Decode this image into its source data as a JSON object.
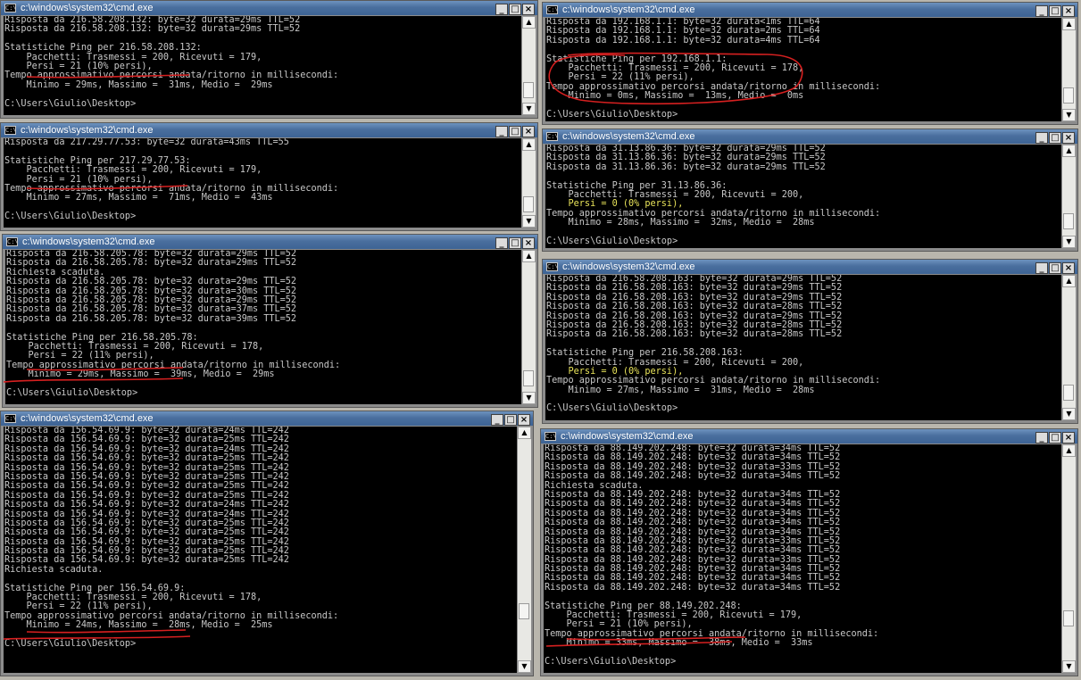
{
  "windows": [
    {
      "title": "c:\\windows\\system32\\cmd.exe",
      "icon": "cmd-icon",
      "thumb": 0.92,
      "lines": [
        "Risposta da 216.58.208.132: byte=32 durata=29ms TTL=52",
        "Risposta da 216.58.208.132: byte=32 durata=29ms TTL=52",
        "",
        "Statistiche Ping per 216.58.208.132:",
        "    Pacchetti: Trasmessi = 200, Ricevuti = 179,",
        "    Persi = 21 (10% persi),",
        "Tempo approssimativo percorsi andata/ritorno in millisecondi:",
        "    Minimo = 29ms, Massimo =  31ms, Medio =  29ms",
        "",
        "C:\\Users\\Giulio\\Desktop>"
      ],
      "highlight": []
    },
    {
      "title": "c:\\windows\\system32\\cmd.exe",
      "icon": "cmd-icon",
      "thumb": 0.95,
      "lines": [
        "Risposta da 217.29.77.53: byte=32 durata=43ms TTL=55",
        "",
        "Statistiche Ping per 217.29.77.53:",
        "    Pacchetti: Trasmessi = 200, Ricevuti = 179,",
        "    Persi = 21 (10% persi),",
        "Tempo approssimativo percorsi andata/ritorno in millisecondi:",
        "    Minimo = 27ms, Massimo =  71ms, Medio =  43ms",
        "",
        "C:\\Users\\Giulio\\Desktop>"
      ],
      "highlight": []
    },
    {
      "title": "c:\\windows\\system32\\cmd.exe",
      "icon": "cmd-icon",
      "thumb": 0.95,
      "lines": [
        "Risposta da 216.58.205.78: byte=32 durata=29ms TTL=52",
        "Risposta da 216.58.205.78: byte=32 durata=29ms TTL=52",
        "Richiesta scaduta.",
        "Risposta da 216.58.205.78: byte=32 durata=29ms TTL=52",
        "Risposta da 216.58.205.78: byte=32 durata=30ms TTL=52",
        "Risposta da 216.58.205.78: byte=32 durata=29ms TTL=52",
        "Risposta da 216.58.205.78: byte=32 durata=37ms TTL=52",
        "Risposta da 216.58.205.78: byte=32 durata=39ms TTL=52",
        "",
        "Statistiche Ping per 216.58.205.78:",
        "    Pacchetti: Trasmessi = 200, Ricevuti = 178,",
        "    Persi = 22 (11% persi),",
        "Tempo approssimativo percorsi andata/ritorno in millisecondi:",
        "    Minimo = 29ms, Massimo =  39ms, Medio =  29ms",
        "",
        "C:\\Users\\Giulio\\Desktop>"
      ],
      "highlight": []
    },
    {
      "title": "c:\\windows\\system32\\cmd.exe",
      "icon": "cmd-icon",
      "thumb": 0.8,
      "lines": [
        "Risposta da 156.54.69.9: byte=32 durata=24ms TTL=242",
        "Risposta da 156.54.69.9: byte=32 durata=25ms TTL=242",
        "Risposta da 156.54.69.9: byte=32 durata=24ms TTL=242",
        "Risposta da 156.54.69.9: byte=32 durata=25ms TTL=242",
        "Risposta da 156.54.69.9: byte=32 durata=25ms TTL=242",
        "Risposta da 156.54.69.9: byte=32 durata=25ms TTL=242",
        "Risposta da 156.54.69.9: byte=32 durata=25ms TTL=242",
        "Risposta da 156.54.69.9: byte=32 durata=25ms TTL=242",
        "Risposta da 156.54.69.9: byte=32 durata=24ms TTL=242",
        "Risposta da 156.54.69.9: byte=32 durata=24ms TTL=242",
        "Risposta da 156.54.69.9: byte=32 durata=25ms TTL=242",
        "Risposta da 156.54.69.9: byte=32 durata=25ms TTL=242",
        "Risposta da 156.54.69.9: byte=32 durata=25ms TTL=242",
        "Risposta da 156.54.69.9: byte=32 durata=25ms TTL=242",
        "Risposta da 156.54.69.9: byte=32 durata=25ms TTL=242",
        "Richiesta scaduta.",
        "",
        "Statistiche Ping per 156.54.69.9:",
        "    Pacchetti: Trasmessi = 200, Ricevuti = 178,",
        "    Persi = 22 (11% persi),",
        "Tempo approssimativo percorsi andata/ritorno in millisecondi:",
        "    Minimo = 24ms, Massimo =  28ms, Medio =  25ms",
        "",
        "C:\\Users\\Giulio\\Desktop>"
      ],
      "highlight": []
    },
    {
      "title": "c:\\windows\\system32\\cmd.exe",
      "icon": "cmd-icon",
      "thumb": 0.92,
      "lines": [
        "Risposta da 192.168.1.1: byte=32 durata<1ms TTL=64",
        "Risposta da 192.168.1.1: byte=32 durata=2ms TTL=64",
        "Risposta da 192.168.1.1: byte=32 durata=4ms TTL=64",
        "",
        "Statistiche Ping per 192.168.1.1:",
        "    Pacchetti: Trasmessi = 200, Ricevuti = 178,",
        "    Persi = 22 (11% persi),",
        "Tempo approssimativo percorsi andata/ritorno in millisecondi:",
        "    Minimo = 0ms, Massimo =  13ms, Medio =  0ms",
        "",
        "C:\\Users\\Giulio\\Desktop>"
      ],
      "highlight": []
    },
    {
      "title": "c:\\windows\\system32\\cmd.exe",
      "icon": "cmd-icon",
      "thumb": 0.9,
      "lines": [
        "Risposta da 31.13.86.36: byte=32 durata=29ms TTL=52",
        "Risposta da 31.13.86.36: byte=32 durata=29ms TTL=52",
        "Risposta da 31.13.86.36: byte=32 durata=29ms TTL=52",
        "",
        "Statistiche Ping per 31.13.86.36:",
        "    Pacchetti: Trasmessi = 200, Ricevuti = 200,",
        "    Persi = 0 (0% persi),",
        "Tempo approssimativo percorsi andata/ritorno in millisecondi:",
        "    Minimo = 28ms, Massimo =  32ms, Medio =  28ms",
        "",
        "C:\\Users\\Giulio\\Desktop>"
      ],
      "highlight": [
        6
      ]
    },
    {
      "title": "c:\\windows\\system32\\cmd.exe",
      "icon": "cmd-icon",
      "thumb": 0.93,
      "lines": [
        "Risposta da 216.58.208.163: byte=32 durata=29ms TTL=52",
        "Risposta da 216.58.208.163: byte=32 durata=29ms TTL=52",
        "Risposta da 216.58.208.163: byte=32 durata=29ms TTL=52",
        "Risposta da 216.58.208.163: byte=32 durata=28ms TTL=52",
        "Risposta da 216.58.208.163: byte=32 durata=29ms TTL=52",
        "Risposta da 216.58.208.163: byte=32 durata=28ms TTL=52",
        "Risposta da 216.58.208.163: byte=32 durata=28ms TTL=52",
        "",
        "Statistiche Ping per 216.58.208.163:",
        "    Pacchetti: Trasmessi = 200, Ricevuti = 200,",
        "    Persi = 0 (0% persi),",
        "Tempo approssimativo percorsi andata/ritorno in millisecondi:",
        "    Minimo = 27ms, Massimo =  31ms, Medio =  28ms",
        "",
        "C:\\Users\\Giulio\\Desktop>"
      ],
      "highlight": [
        10
      ]
    },
    {
      "title": "c:\\windows\\system32\\cmd.exe",
      "icon": "cmd-icon",
      "thumb": 0.82,
      "lines": [
        "Risposta da 88.149.202.248: byte=32 durata=34ms TTL=52",
        "Risposta da 88.149.202.248: byte=32 durata=34ms TTL=52",
        "Risposta da 88.149.202.248: byte=32 durata=33ms TTL=52",
        "Risposta da 88.149.202.248: byte=32 durata=34ms TTL=52",
        "Richiesta scaduta.",
        "Risposta da 88.149.202.248: byte=32 durata=34ms TTL=52",
        "Risposta da 88.149.202.248: byte=32 durata=34ms TTL=52",
        "Risposta da 88.149.202.248: byte=32 durata=34ms TTL=52",
        "Risposta da 88.149.202.248: byte=32 durata=34ms TTL=52",
        "Risposta da 88.149.202.248: byte=32 durata=34ms TTL=52",
        "Risposta da 88.149.202.248: byte=32 durata=33ms TTL=52",
        "Risposta da 88.149.202.248: byte=32 durata=34ms TTL=52",
        "Risposta da 88.149.202.248: byte=32 durata=33ms TTL=52",
        "Risposta da 88.149.202.248: byte=32 durata=34ms TTL=52",
        "Risposta da 88.149.202.248: byte=32 durata=34ms TTL=52",
        "Risposta da 88.149.202.248: byte=32 durata=34ms TTL=52",
        "",
        "Statistiche Ping per 88.149.202.248:",
        "    Pacchetti: Trasmessi = 200, Ricevuti = 179,",
        "    Persi = 21 (10% persi),",
        "Tempo approssimativo percorsi andata/ritorno in millisecondi:",
        "    Minimo = 33ms, Massimo =  38ms, Medio =  33ms",
        "",
        "C:\\Users\\Giulio\\Desktop>"
      ],
      "highlight": []
    }
  ],
  "colors": {
    "console_text": "#c8c8c8",
    "highlight_text": "#e9e45a",
    "annotation": "#d62020"
  }
}
